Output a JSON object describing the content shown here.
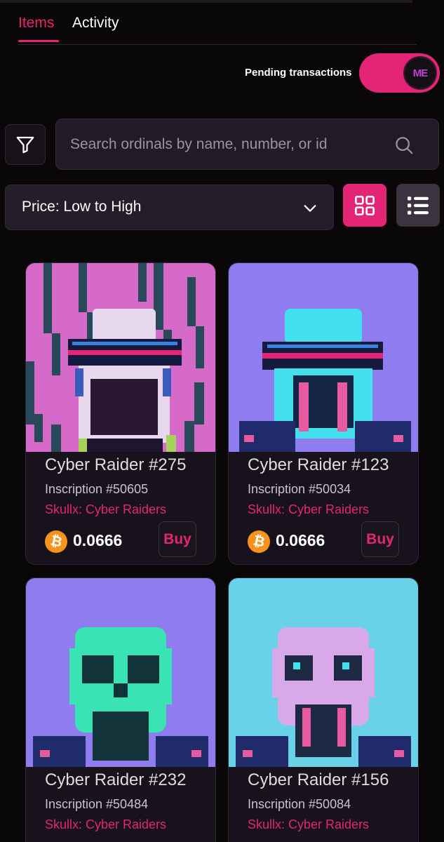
{
  "tabs": [
    {
      "label": "Items",
      "active": true
    },
    {
      "label": "Activity",
      "active": false
    }
  ],
  "pending": {
    "label": "Pending transactions",
    "badge_text": "ME"
  },
  "search": {
    "placeholder": "Search ordinals by name, number, or id",
    "value": ""
  },
  "sort": {
    "selected": "Price: Low to High"
  },
  "view": {
    "active": "grid"
  },
  "cards": [
    {
      "name": "Cyber Raider #275",
      "inscription": "Inscription #50605",
      "collection": "Skullx: Cyber Raiders",
      "price": "0.0666",
      "buy_label": "Buy"
    },
    {
      "name": "Cyber Raider #123",
      "inscription": "Inscription #50034",
      "collection": "Skullx: Cyber Raiders",
      "price": "0.0666",
      "buy_label": "Buy"
    },
    {
      "name": "Cyber Raider #232",
      "inscription": "Inscription #50484",
      "collection": "Skullx: Cyber Raiders",
      "price": "",
      "buy_label": ""
    },
    {
      "name": "Cyber Raider #156",
      "inscription": "Inscription #50084",
      "collection": "Skullx: Cyber Raiders",
      "price": "",
      "buy_label": ""
    }
  ],
  "colors": {
    "accent": "#e42575",
    "background": "#0a0709",
    "bitcoin": "#f7931a"
  },
  "icons": [
    "filter-icon",
    "search-icon",
    "chevron-down-icon",
    "grid-view-icon",
    "list-view-icon",
    "bitcoin-icon",
    "magic-eden-logo"
  ]
}
